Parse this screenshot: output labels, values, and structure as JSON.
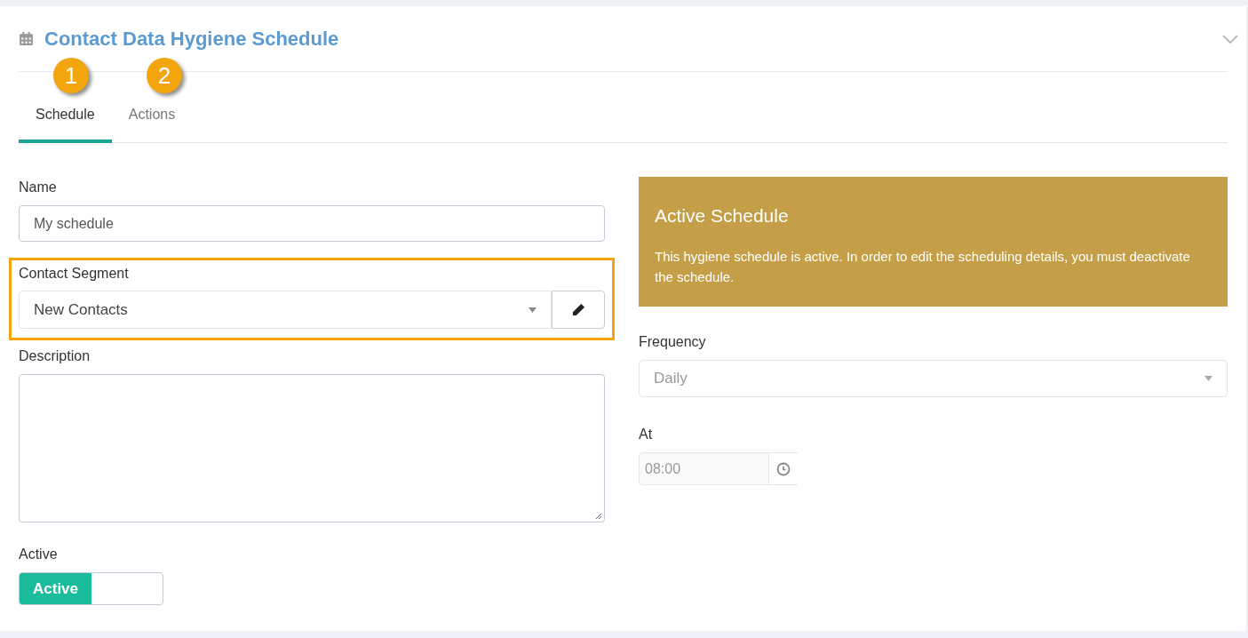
{
  "panel": {
    "title": "Contact Data Hygiene Schedule",
    "expanded": true
  },
  "callouts": [
    {
      "label": "1"
    },
    {
      "label": "2"
    }
  ],
  "tabs": [
    {
      "label": "Schedule",
      "selected": true
    },
    {
      "label": "Actions",
      "selected": false
    }
  ],
  "form": {
    "name": {
      "label": "Name",
      "value": "My schedule"
    },
    "segment": {
      "label": "Contact Segment",
      "value": "New Contacts",
      "highlighted": true
    },
    "description": {
      "label": "Description"
    },
    "active": {
      "label": "Active",
      "toggle_label": "Active",
      "on": true
    }
  },
  "notice": {
    "title": "Active Schedule",
    "text": "This hygiene schedule is active. In order to edit the scheduling details, you must deactivate the schedule."
  },
  "frequency": {
    "label": "Frequency",
    "value": "Daily",
    "disabled": true
  },
  "at": {
    "label": "At",
    "value": "08:00",
    "disabled": true
  }
}
